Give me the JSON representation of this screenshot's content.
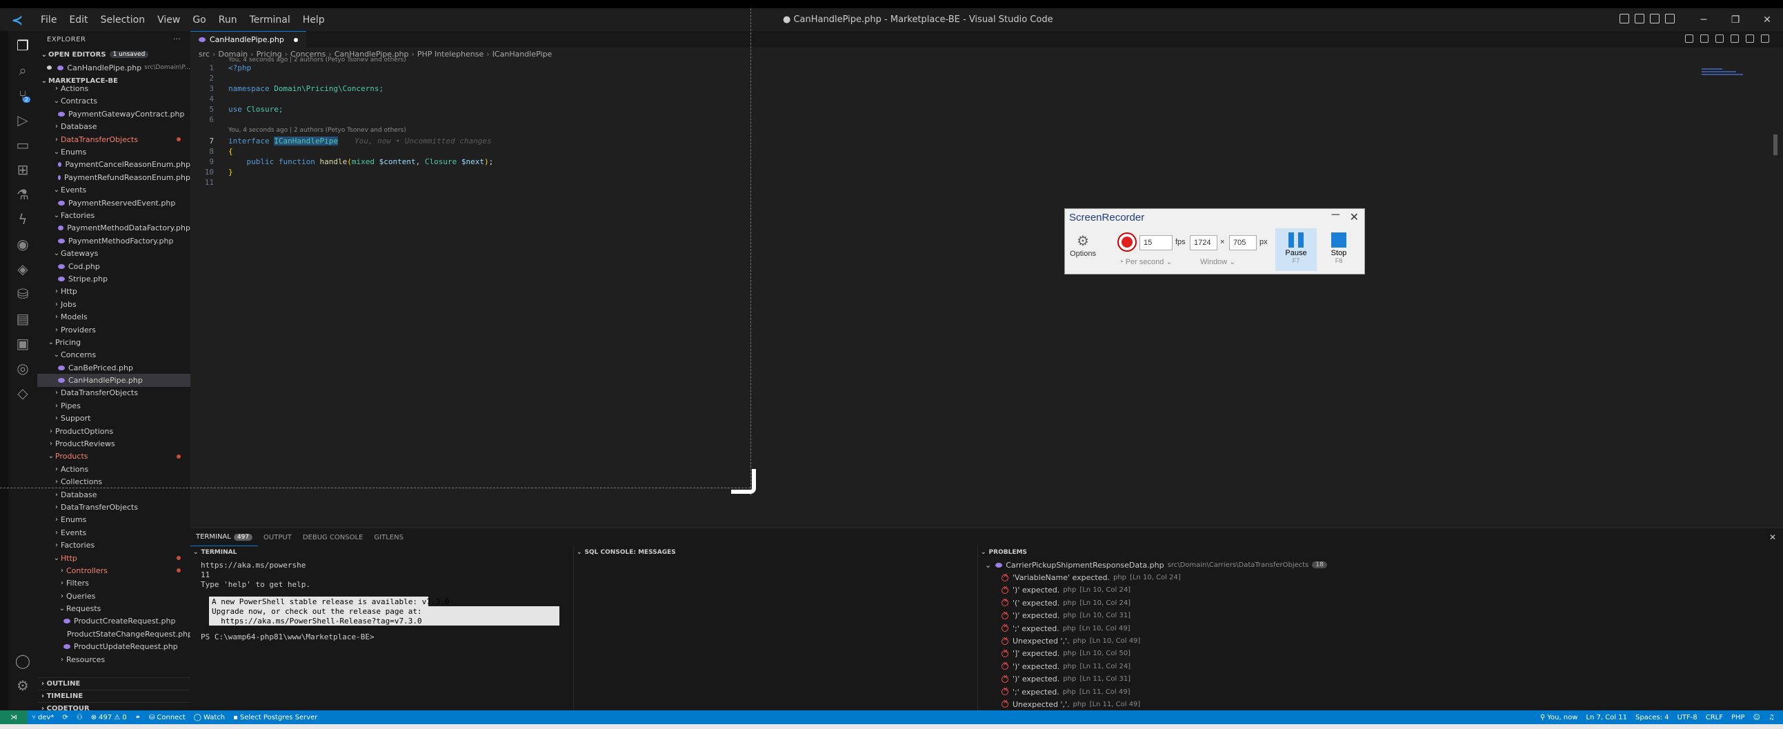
{
  "window": {
    "title": "● CanHandlePipe.php - Marketplace-BE - Visual Studio Code"
  },
  "menu": [
    "File",
    "Edit",
    "Selection",
    "View",
    "Go",
    "Run",
    "Terminal",
    "Help"
  ],
  "explorer": {
    "header": "EXPLORER",
    "open_editors": "OPEN EDITORS",
    "unsaved_badge": "1 unsaved",
    "open_file": "CanHandlePipe.php",
    "open_file_path": "src\\Domain\\P...",
    "project": "MARKETPLACE-BE",
    "tree": [
      {
        "label": "Actions",
        "indent": 2,
        "type": "folder",
        "open": false
      },
      {
        "label": "Contracts",
        "indent": 2,
        "type": "folder",
        "open": true
      },
      {
        "label": "PaymentGatewayContract.php",
        "indent": 3,
        "type": "file"
      },
      {
        "label": "Database",
        "indent": 2,
        "type": "folder",
        "open": false
      },
      {
        "label": "DataTransferObjects",
        "indent": 2,
        "type": "folder",
        "open": false,
        "red": true
      },
      {
        "label": "Enums",
        "indent": 2,
        "type": "folder",
        "open": true
      },
      {
        "label": "PaymentCancelReasonEnum.php",
        "indent": 3,
        "type": "file"
      },
      {
        "label": "PaymentRefundReasonEnum.php",
        "indent": 3,
        "type": "file"
      },
      {
        "label": "Events",
        "indent": 2,
        "type": "folder",
        "open": true
      },
      {
        "label": "PaymentReservedEvent.php",
        "indent": 3,
        "type": "file"
      },
      {
        "label": "Factories",
        "indent": 2,
        "type": "folder",
        "open": true
      },
      {
        "label": "PaymentMethodDataFactory.php",
        "indent": 3,
        "type": "file"
      },
      {
        "label": "PaymentMethodFactory.php",
        "indent": 3,
        "type": "file"
      },
      {
        "label": "Gateways",
        "indent": 2,
        "type": "folder",
        "open": true
      },
      {
        "label": "Cod.php",
        "indent": 3,
        "type": "file"
      },
      {
        "label": "Stripe.php",
        "indent": 3,
        "type": "file"
      },
      {
        "label": "Http",
        "indent": 2,
        "type": "folder",
        "open": false
      },
      {
        "label": "Jobs",
        "indent": 2,
        "type": "folder",
        "open": false
      },
      {
        "label": "Models",
        "indent": 2,
        "type": "folder",
        "open": false
      },
      {
        "label": "Providers",
        "indent": 2,
        "type": "folder",
        "open": false
      },
      {
        "label": "Pricing",
        "indent": 1,
        "type": "folder",
        "open": true
      },
      {
        "label": "Concerns",
        "indent": 2,
        "type": "folder",
        "open": true
      },
      {
        "label": "CanBePriced.php",
        "indent": 3,
        "type": "file"
      },
      {
        "label": "CanHandlePipe.php",
        "indent": 3,
        "type": "file",
        "selected": true
      },
      {
        "label": "DataTransferObjects",
        "indent": 2,
        "type": "folder",
        "open": false
      },
      {
        "label": "Pipes",
        "indent": 2,
        "type": "folder",
        "open": false
      },
      {
        "label": "Support",
        "indent": 2,
        "type": "folder",
        "open": false
      },
      {
        "label": "ProductOptions",
        "indent": 1,
        "type": "folder",
        "open": false
      },
      {
        "label": "ProductReviews",
        "indent": 1,
        "type": "folder",
        "open": false
      },
      {
        "label": "Products",
        "indent": 1,
        "type": "folder",
        "open": true,
        "red": true
      },
      {
        "label": "Actions",
        "indent": 2,
        "type": "folder",
        "open": false
      },
      {
        "label": "Collections",
        "indent": 2,
        "type": "folder",
        "open": false
      },
      {
        "label": "Database",
        "indent": 2,
        "type": "folder",
        "open": false
      },
      {
        "label": "DataTransferObjects",
        "indent": 2,
        "type": "folder",
        "open": false
      },
      {
        "label": "Enums",
        "indent": 2,
        "type": "folder",
        "open": false
      },
      {
        "label": "Events",
        "indent": 2,
        "type": "folder",
        "open": false
      },
      {
        "label": "Factories",
        "indent": 2,
        "type": "folder",
        "open": false
      },
      {
        "label": "Http",
        "indent": 2,
        "type": "folder",
        "open": true,
        "red": true
      },
      {
        "label": "Controllers",
        "indent": 3,
        "type": "folder",
        "open": false,
        "red": true
      },
      {
        "label": "Filters",
        "indent": 3,
        "type": "folder",
        "open": false
      },
      {
        "label": "Queries",
        "indent": 3,
        "type": "folder",
        "open": false
      },
      {
        "label": "Requests",
        "indent": 3,
        "type": "folder",
        "open": true
      },
      {
        "label": "ProductCreateRequest.php",
        "indent": 4,
        "type": "file"
      },
      {
        "label": "ProductStateChangeRequest.php",
        "indent": 4,
        "type": "file"
      },
      {
        "label": "ProductUpdateRequest.php",
        "indent": 4,
        "type": "file"
      },
      {
        "label": "Resources",
        "indent": 3,
        "type": "folder",
        "open": false
      }
    ],
    "outline": "OUTLINE",
    "timeline": "TIMELINE",
    "codetour": "CODETOUR"
  },
  "editor": {
    "tab": "CanHandlePipe.php",
    "breadcrumb": [
      "src",
      "Domain",
      "Pricing",
      "Concerns",
      "CanHandlePipe.php",
      "PHP Intelephense",
      "ICanHandlePipe"
    ],
    "lens1": "You, 4 seconds ago | 2 authors (Petyo Tsonev and others)",
    "lens2": "You, 4 seconds ago | 2 authors (Petyo Tsonev and others)",
    "ghost": "You, now • Uncommitted changes",
    "line_numbers": [
      "1",
      "2",
      "3",
      "4",
      "5",
      "6",
      "7",
      "8",
      "9",
      "10",
      "11"
    ],
    "l1": "<?php",
    "l3_kw": "namespace",
    "l3_ns": "Domain\\Pricing\\Concerns;",
    "l5_kw": "use",
    "l5_ns": "Closure;",
    "l7_kw": "interface",
    "l7_name": "ICanHandlePipe",
    "l8": "{",
    "l9_kw1": "public",
    "l9_kw2": "function",
    "l9_fn": "handle",
    "l9_t1": "mixed",
    "l9_v1": "$content",
    "l9_t2": "Closure",
    "l9_v2": "$next",
    "l10": "}"
  },
  "recorder": {
    "title": "ScreenRecorder",
    "options": "Options",
    "fps_value": "15",
    "fps_label": "fps",
    "width": "1724",
    "times": "×",
    "height": "705",
    "px": "px",
    "per_second": "Per second",
    "window": "Window",
    "pause": "Pause",
    "pause_key": "F7",
    "stop": "Stop",
    "stop_key": "F8"
  },
  "panel": {
    "tabs": [
      {
        "label": "TERMINAL",
        "count": "497"
      },
      {
        "label": "OUTPUT"
      },
      {
        "label": "DEBUG CONSOLE"
      },
      {
        "label": "GITLENS"
      }
    ],
    "terminal_head": "TERMINAL",
    "sql_head": "SQL CONSOLE: MESSAGES",
    "problems_head": "PROBLEMS",
    "terminal_lines": [
      "https://aka.ms/powershe",
      "11",
      "Type 'help' to get help."
    ],
    "notice": [
      "A new PowerShell stable release is available: v7.3.0",
      "Upgrade now, or check out the release page at:",
      "  https://aka.ms/PowerShell-Release?tag=v7.3.0"
    ],
    "prompt": "PS C:\\wamp64-php81\\www\\Marketplace-BE>",
    "problem_file": "CarrierPickupShipmentResponseData.php",
    "problem_path": "src\\Domain\\Carriers\\DataTransferObjects",
    "problem_count": "18",
    "problems": [
      {
        "msg": "'VariableName' expected.",
        "src": "php",
        "loc": "[Ln 10, Col 24]"
      },
      {
        "msg": "')' expected.",
        "src": "php",
        "loc": "[Ln 10, Col 24]"
      },
      {
        "msg": "'(' expected.",
        "src": "php",
        "loc": "[Ln 10, Col 24]"
      },
      {
        "msg": "')' expected.",
        "src": "php",
        "loc": "[Ln 10, Col 31]"
      },
      {
        "msg": "';' expected.",
        "src": "php",
        "loc": "[Ln 10, Col 49]"
      },
      {
        "msg": "Unexpected ','.",
        "src": "php",
        "loc": "[Ln 10, Col 49]"
      },
      {
        "msg": "']' expected.",
        "src": "php",
        "loc": "[Ln 10, Col 50]"
      },
      {
        "msg": "')' expected.",
        "src": "php",
        "loc": "[Ln 11, Col 24]"
      },
      {
        "msg": "')' expected.",
        "src": "php",
        "loc": "[Ln 11, Col 31]"
      },
      {
        "msg": "';' expected.",
        "src": "php",
        "loc": "[Ln 11, Col 49]"
      },
      {
        "msg": "Unexpected ','.",
        "src": "php",
        "loc": "[Ln 11, Col 49]"
      }
    ]
  },
  "status": {
    "branch": "dev*",
    "problems": "497",
    "warnings": "0",
    "connect": "Connect",
    "watch": "Watch",
    "postgres": "Select Postgres Server",
    "blame": "You, now",
    "position": "Ln 7, Col 11",
    "spaces": "Spaces: 4",
    "encoding": "UTF-8",
    "eol": "CRLF",
    "lang": "PHP"
  }
}
